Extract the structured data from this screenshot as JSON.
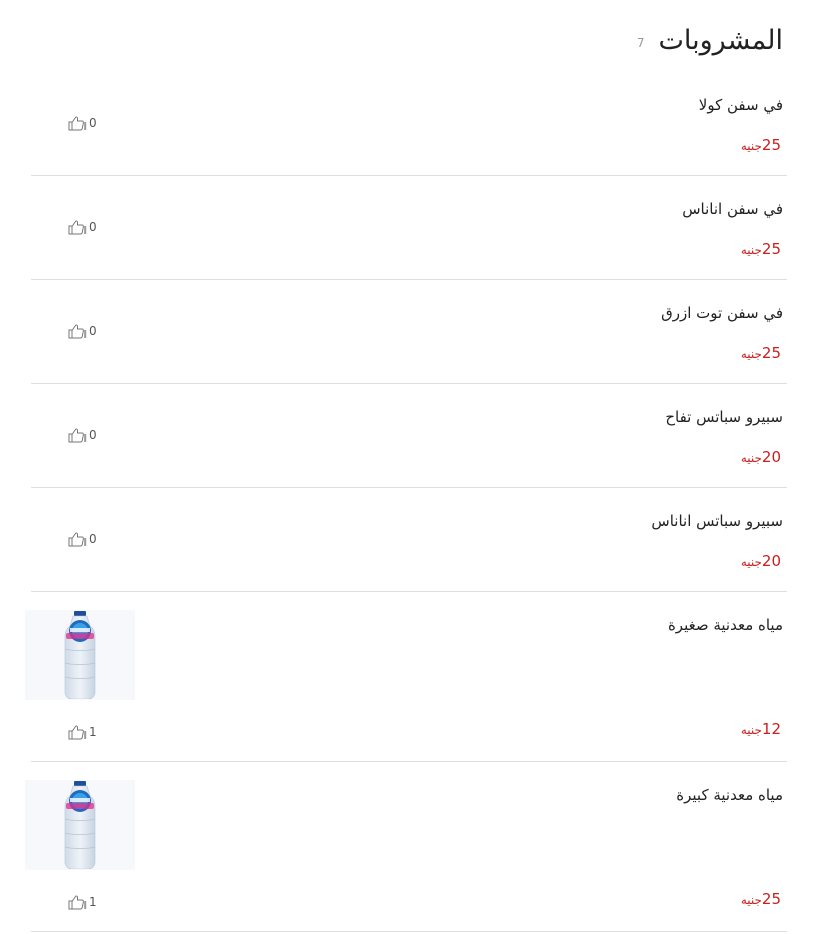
{
  "header": {
    "title": "المشروبات",
    "count": "7"
  },
  "items": [
    {
      "name": "في سفن كولا",
      "price": "25",
      "currency": "جنيه",
      "likes": "0",
      "has_image": false
    },
    {
      "name": "في سفن اناناس",
      "price": "25",
      "currency": "جنيه",
      "likes": "0",
      "has_image": false
    },
    {
      "name": "في سفن توت ازرق",
      "price": "25",
      "currency": "جنيه",
      "likes": "0",
      "has_image": false
    },
    {
      "name": "سبيرو سباتس تفاح",
      "price": "20",
      "currency": "جنيه",
      "likes": "0",
      "has_image": false
    },
    {
      "name": "سبيرو سباتس اناناس",
      "price": "20",
      "currency": "جنيه",
      "likes": "0",
      "has_image": false
    },
    {
      "name": "مياه معدنية صغيرة",
      "price": "12",
      "currency": "جنيه",
      "likes": "1",
      "has_image": true,
      "image_icon": "water-bottle-icon"
    },
    {
      "name": "مياه معدنية كبيرة",
      "price": "25",
      "currency": "جنيه",
      "likes": "1",
      "has_image": true,
      "image_icon": "water-bottle-icon"
    }
  ],
  "colors": {
    "price": "#c8201e",
    "divider": "#dedede",
    "text": "#222222",
    "muted": "#999999"
  },
  "icons": {
    "like": "thumbs-up-icon"
  }
}
